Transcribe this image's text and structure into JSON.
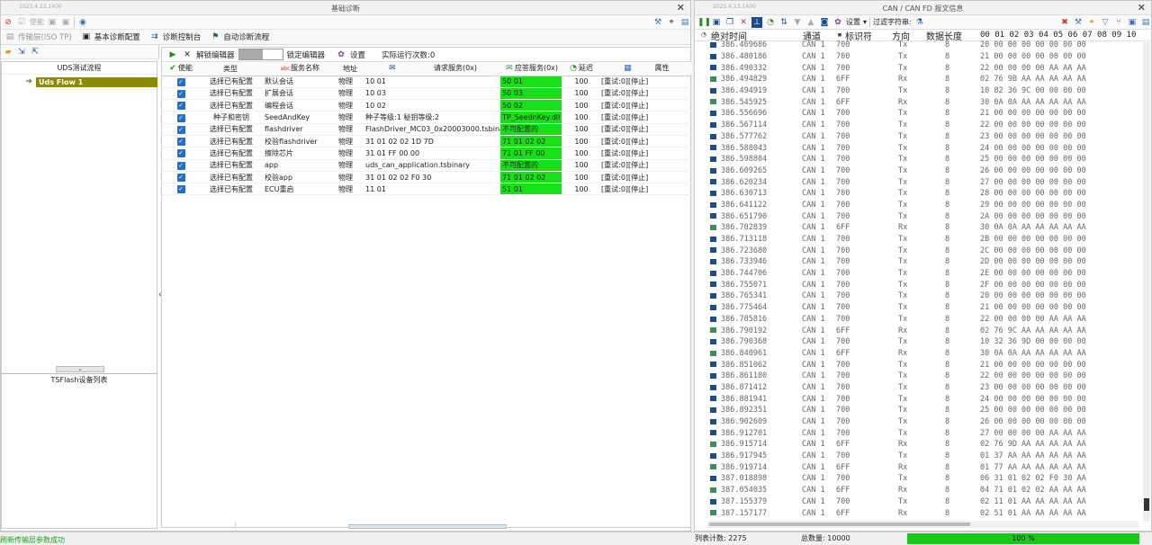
{
  "left": {
    "version": "2025.4.23.1400",
    "window_title": "基础诊断",
    "toolbar": {
      "enable_label": "使能"
    },
    "tabs": [
      {
        "label": "传输层(ISO TP)",
        "active": false
      },
      {
        "label": "基本诊断配置",
        "active": true
      },
      {
        "label": "诊断控制台",
        "active": true
      },
      {
        "label": "自动诊断流程",
        "active": true
      }
    ],
    "tree": {
      "header": "UDS测试流程",
      "flow_label": "Uds Flow 1",
      "device_header": "TSFlash设备列表"
    },
    "editor": {
      "unlock_label": "解锁编辑器",
      "lock_label": "锁定编辑器",
      "settings_label": "设置",
      "run_count": "实际运行次数:0"
    },
    "grid": {
      "headers": [
        "使能",
        "类型",
        "服务名称",
        "地址",
        "请求服务(0x)",
        "应答服务(0x)",
        "延迟",
        "属性"
      ],
      "rows": [
        {
          "type": "选择已有配置",
          "name": "默认会话",
          "addr": "物理",
          "req": "10 01",
          "rsp": "50 01",
          "delay": "100",
          "attr": "[重试:0][停止]"
        },
        {
          "type": "选择已有配置",
          "name": "扩展会话",
          "addr": "物理",
          "req": "10 03",
          "rsp": "50 03",
          "delay": "100",
          "attr": "[重试:0][停止]"
        },
        {
          "type": "选择已有配置",
          "name": "编程会话",
          "addr": "物理",
          "req": "10 02",
          "rsp": "50 02",
          "delay": "100",
          "attr": "[重试:0][停止]"
        },
        {
          "type": "种子和密钥",
          "name": "SeedAndKey",
          "addr": "物理",
          "req": "种子等级:1 秘钥等级:2",
          "rsp": "TP_SeednKey.dll",
          "delay": "100",
          "attr": "[重试:0][停止]"
        },
        {
          "type": "选择已有配置",
          "name": "flashdriver",
          "addr": "物理",
          "req": "FlashDriver_MC03_0x20003000.tsbinary",
          "rsp": "不可配置的",
          "delay": "100",
          "attr": "[重试:0][停止]"
        },
        {
          "type": "选择已有配置",
          "name": "校验flashdriver",
          "addr": "物理",
          "req": "31 01 02 02 1D 7D",
          "rsp": "71 01 02 02",
          "delay": "100",
          "attr": "[重试:0][停止]"
        },
        {
          "type": "选择已有配置",
          "name": "擦除芯片",
          "addr": "物理",
          "req": "31 01 FF 00 00",
          "rsp": "71 01 FF 00",
          "delay": "100",
          "attr": "[重试:0][停止]"
        },
        {
          "type": "选择已有配置",
          "name": "app",
          "addr": "物理",
          "req": "uds_can_application.tsbinary",
          "rsp": "不可配置的",
          "delay": "100",
          "attr": "[重试:0][停止]"
        },
        {
          "type": "选择已有配置",
          "name": "校验app",
          "addr": "物理",
          "req": "31 01 02 02 F0 30",
          "rsp": "71 01 02 02",
          "delay": "100",
          "attr": "[重试:0][停止]"
        },
        {
          "type": "选择已有配置",
          "name": "ECU重启",
          "addr": "物理",
          "req": "11 01",
          "rsp": "51 01",
          "delay": "100",
          "attr": "[重试:0][停止]"
        }
      ]
    }
  },
  "right": {
    "version": "2025.4.23.1400",
    "window_title": "CAN / CAN FD 报文信息",
    "toolbar": {
      "settings_label": "设置",
      "filter_label": "过滤字符串:"
    },
    "headers": {
      "time": "绝对时间",
      "channel": "通道",
      "id": "标识符",
      "dir": "方向",
      "dlc": "数据长度",
      "bytes": "00 01 02 03 04 05 06 07 08 09 10"
    },
    "messages": [
      [
        "386.469686",
        "CAN 1",
        "700",
        "Tx",
        "8",
        "20 00 00 00 00 00 00 00"
      ],
      [
        "386.480186",
        "CAN 1",
        "700",
        "Tx",
        "8",
        "21 00 00 00 00 00 00 00"
      ],
      [
        "386.490332",
        "CAN 1",
        "700",
        "Tx",
        "8",
        "22 00 00 00 00 AA AA AA"
      ],
      [
        "386.494829",
        "CAN 1",
        "6FF",
        "Rx",
        "8",
        "02 76 9B AA AA AA AA AA"
      ],
      [
        "386.494919",
        "CAN 1",
        "700",
        "Tx",
        "8",
        "10 82 36 9C 00 00 00 00"
      ],
      [
        "386.545925",
        "CAN 1",
        "6FF",
        "Rx",
        "8",
        "30 0A 0A AA AA AA AA AA"
      ],
      [
        "386.556696",
        "CAN 1",
        "700",
        "Tx",
        "8",
        "21 00 00 00 00 00 00 00"
      ],
      [
        "386.567114",
        "CAN 1",
        "700",
        "Tx",
        "8",
        "22 00 00 00 00 00 00 00"
      ],
      [
        "386.577762",
        "CAN 1",
        "700",
        "Tx",
        "8",
        "23 00 00 00 00 00 00 00"
      ],
      [
        "386.588043",
        "CAN 1",
        "700",
        "Tx",
        "8",
        "24 00 00 00 00 00 00 00"
      ],
      [
        "386.598804",
        "CAN 1",
        "700",
        "Tx",
        "8",
        "25 00 00 00 00 00 00 00"
      ],
      [
        "386.609265",
        "CAN 1",
        "700",
        "Tx",
        "8",
        "26 00 00 00 00 00 00 00"
      ],
      [
        "386.620234",
        "CAN 1",
        "700",
        "Tx",
        "8",
        "27 00 00 00 00 00 00 00"
      ],
      [
        "386.630713",
        "CAN 1",
        "700",
        "Tx",
        "8",
        "28 00 00 00 00 00 00 00"
      ],
      [
        "386.641122",
        "CAN 1",
        "700",
        "Tx",
        "8",
        "29 00 00 00 00 00 00 00"
      ],
      [
        "386.651790",
        "CAN 1",
        "700",
        "Tx",
        "8",
        "2A 00 00 00 00 00 00 00"
      ],
      [
        "386.702839",
        "CAN 1",
        "6FF",
        "Rx",
        "8",
        "30 0A 0A AA AA AA AA AA"
      ],
      [
        "386.713118",
        "CAN 1",
        "700",
        "Tx",
        "8",
        "2B 00 00 00 00 00 00 00"
      ],
      [
        "386.723680",
        "CAN 1",
        "700",
        "Tx",
        "8",
        "2C 00 00 00 00 00 00 00"
      ],
      [
        "386.733946",
        "CAN 1",
        "700",
        "Tx",
        "8",
        "2D 00 00 00 00 00 00 00"
      ],
      [
        "386.744706",
        "CAN 1",
        "700",
        "Tx",
        "8",
        "2E 00 00 00 00 00 00 00"
      ],
      [
        "386.755071",
        "CAN 1",
        "700",
        "Tx",
        "8",
        "2F 00 00 00 00 00 00 00"
      ],
      [
        "386.765341",
        "CAN 1",
        "700",
        "Tx",
        "8",
        "20 00 00 00 00 00 00 00"
      ],
      [
        "386.775464",
        "CAN 1",
        "700",
        "Tx",
        "8",
        "21 00 00 00 00 00 00 00"
      ],
      [
        "386.785816",
        "CAN 1",
        "700",
        "Tx",
        "8",
        "22 00 00 00 00 AA AA AA"
      ],
      [
        "386.790192",
        "CAN 1",
        "6FF",
        "Rx",
        "8",
        "02 76 9C AA AA AA AA AA"
      ],
      [
        "386.790368",
        "CAN 1",
        "700",
        "Tx",
        "8",
        "10 32 36 9D 00 00 00 00"
      ],
      [
        "386.840961",
        "CAN 1",
        "6FF",
        "Rx",
        "8",
        "30 0A 0A AA AA AA AA AA"
      ],
      [
        "386.851062",
        "CAN 1",
        "700",
        "Tx",
        "8",
        "21 00 00 00 00 00 00 00"
      ],
      [
        "386.861180",
        "CAN 1",
        "700",
        "Tx",
        "8",
        "22 00 00 00 00 00 00 00"
      ],
      [
        "386.871412",
        "CAN 1",
        "700",
        "Tx",
        "8",
        "23 00 00 00 00 00 00 00"
      ],
      [
        "386.881941",
        "CAN 1",
        "700",
        "Tx",
        "8",
        "24 00 00 00 00 00 00 00"
      ],
      [
        "386.892351",
        "CAN 1",
        "700",
        "Tx",
        "8",
        "25 00 00 00 00 00 00 00"
      ],
      [
        "386.902609",
        "CAN 1",
        "700",
        "Tx",
        "8",
        "26 00 00 00 00 00 00 00"
      ],
      [
        "386.912701",
        "CAN 1",
        "700",
        "Tx",
        "8",
        "27 00 00 00 00 AA AA AA"
      ],
      [
        "386.915714",
        "CAN 1",
        "6FF",
        "Rx",
        "8",
        "02 76 9D AA AA AA AA AA"
      ],
      [
        "386.917945",
        "CAN 1",
        "700",
        "Tx",
        "8",
        "01 37 AA AA AA AA AA AA"
      ],
      [
        "386.919714",
        "CAN 1",
        "6FF",
        "Rx",
        "8",
        "01 77 AA AA AA AA AA AA"
      ],
      [
        "387.018898",
        "CAN 1",
        "700",
        "Tx",
        "8",
        "06 31 01 02 02 F0 30 AA"
      ],
      [
        "387.054035",
        "CAN 1",
        "6FF",
        "Rx",
        "8",
        "04 71 01 02 02 AA AA AA"
      ],
      [
        "387.155379",
        "CAN 1",
        "700",
        "Tx",
        "8",
        "02 11 01 AA AA AA AA AA"
      ],
      [
        "387.157177",
        "CAN 1",
        "6FF",
        "Rx",
        "8",
        "02 51 01 AA AA AA AA AA"
      ]
    ]
  },
  "status": {
    "left_message": "刷新传输层参数成功",
    "list_count": "列表计数: 2275",
    "total_count": "总数量: 10000",
    "progress_text": "100 %",
    "progress": 1.0
  },
  "colors": {
    "ok_green": "#18e018",
    "flow_selected": "#8b8b00",
    "tx_icon": "#1a4d8f",
    "rx_icon": "#3b8f5a"
  }
}
